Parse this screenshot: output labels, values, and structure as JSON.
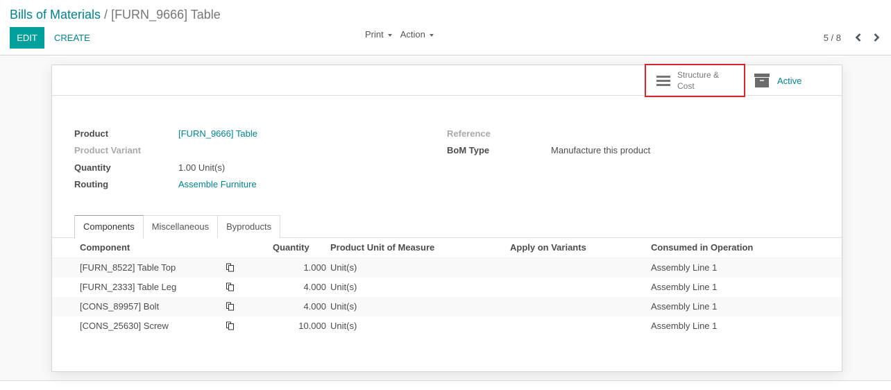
{
  "breadcrumb": {
    "parent": "Bills of Materials",
    "separator": "/",
    "current": "[FURN_9666] Table"
  },
  "toolbar": {
    "edit_label": "EDIT",
    "create_label": "CREATE",
    "print_label": "Print",
    "action_label": "Action"
  },
  "pager": {
    "value": "5 / 8"
  },
  "stat_buttons": {
    "structure_cost": "Structure & Cost",
    "active": "Active"
  },
  "fields": {
    "product_label": "Product",
    "product_value": "[FURN_9666] Table",
    "product_variant_label": "Product Variant",
    "quantity_label": "Quantity",
    "quantity_value": "1.00 Unit(s)",
    "routing_label": "Routing",
    "routing_value": "Assemble Furniture",
    "reference_label": "Reference",
    "bom_type_label": "BoM Type",
    "bom_type_value": "Manufacture this product"
  },
  "tabs": [
    {
      "label": "Components"
    },
    {
      "label": "Miscellaneous"
    },
    {
      "label": "Byproducts"
    }
  ],
  "table": {
    "headers": {
      "component": "Component",
      "quantity": "Quantity",
      "uom": "Product Unit of Measure",
      "variants": "Apply on Variants",
      "operation": "Consumed in Operation"
    },
    "rows": [
      {
        "component": "[FURN_8522] Table Top",
        "quantity": "1.000",
        "uom": "Unit(s)",
        "variants": "",
        "operation": "Assembly Line 1"
      },
      {
        "component": "[FURN_2333] Table Leg",
        "quantity": "4.000",
        "uom": "Unit(s)",
        "variants": "",
        "operation": "Assembly Line 1"
      },
      {
        "component": "[CONS_89957] Bolt",
        "quantity": "4.000",
        "uom": "Unit(s)",
        "variants": "",
        "operation": "Assembly Line 1"
      },
      {
        "component": "[CONS_25630] Screw",
        "quantity": "10.000",
        "uom": "Unit(s)",
        "variants": "",
        "operation": "Assembly Line 1"
      }
    ]
  },
  "colors": {
    "primary": "#00a09d",
    "link": "#00838f",
    "highlight_border": "#d9262c"
  }
}
